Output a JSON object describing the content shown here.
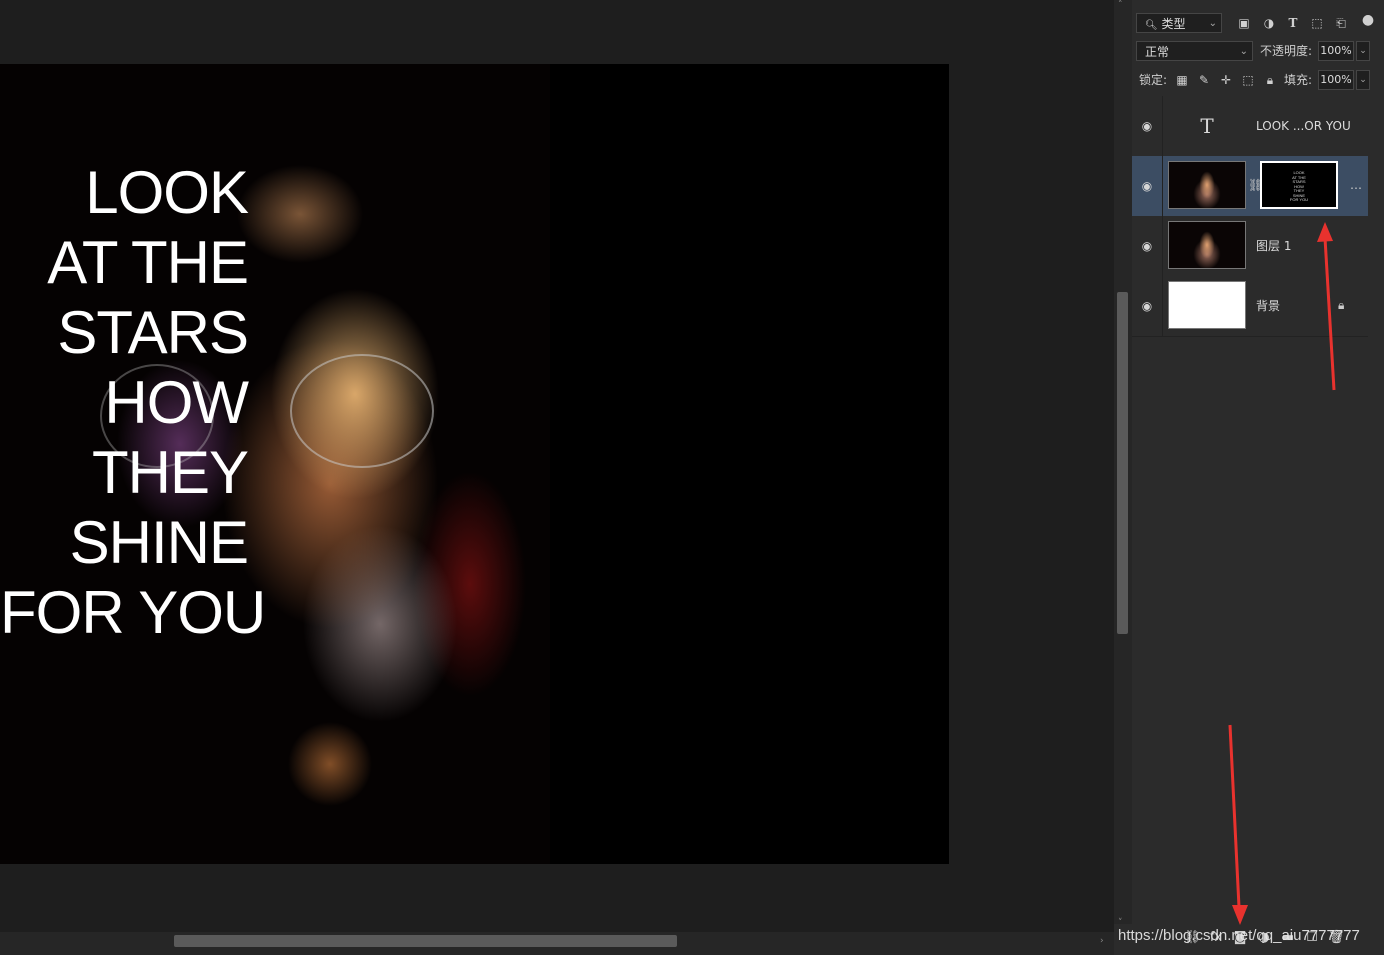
{
  "canvas": {
    "poster_lines": [
      "LOOK",
      "AT THE",
      "STARS",
      "HOW",
      "THEY",
      "SHINE",
      "FOR YOU"
    ]
  },
  "panel": {
    "filter": {
      "label": "类型"
    },
    "blend_mode": "正常",
    "opacity_label": "不透明度:",
    "opacity_value": "100%",
    "lock_label": "锁定:",
    "fill_label": "填充:",
    "fill_value": "100%",
    "layers": [
      {
        "name": "LOOK ...OR YOU",
        "kind": "text"
      },
      {
        "name": "",
        "kind": "photo-with-mask",
        "selected": true
      },
      {
        "name": "图层 1",
        "kind": "photo"
      },
      {
        "name": "背景",
        "kind": "background",
        "locked": true
      }
    ],
    "mask_preview_text": [
      "LOOK",
      "AT THE",
      "STARS",
      "HOW",
      "THEY",
      "SHINE",
      "FOR YOU"
    ]
  },
  "watermark": "https://blog.csdn.net/qq_aiu7777777",
  "annotation_color": "#e8322e"
}
